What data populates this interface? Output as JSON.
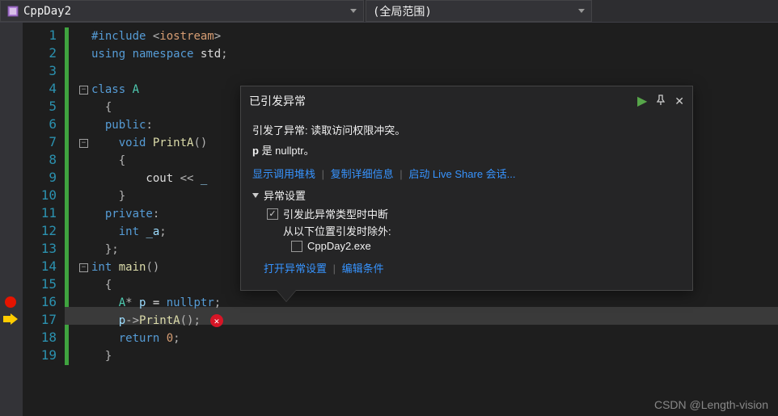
{
  "topbar": {
    "project": "CppDay2",
    "scope": "(全局范围)"
  },
  "code": {
    "lines": [
      {
        "n": 1,
        "t": [
          [
            "kw",
            "#include "
          ],
          [
            "op",
            "<"
          ],
          [
            "str",
            "iostream"
          ],
          [
            "op",
            ">"
          ]
        ]
      },
      {
        "n": 2,
        "t": [
          [
            "kw",
            "using namespace "
          ],
          [
            "white",
            "std"
          ],
          [
            "op",
            ";"
          ]
        ]
      },
      {
        "n": 3,
        "t": []
      },
      {
        "n": 4,
        "outline": true,
        "t": [
          [
            "kw",
            "class "
          ],
          [
            "type",
            "A"
          ]
        ]
      },
      {
        "n": 5,
        "t": [
          [
            "op",
            "  {"
          ]
        ]
      },
      {
        "n": 6,
        "t": [
          [
            "kw",
            "  public"
          ],
          [
            "op",
            ":"
          ]
        ]
      },
      {
        "n": 7,
        "outline": true,
        "t": [
          [
            "white",
            "    "
          ],
          [
            "kw",
            "void "
          ],
          [
            "func",
            "PrintA"
          ],
          [
            "op",
            "()"
          ]
        ]
      },
      {
        "n": 8,
        "t": [
          [
            "op",
            "    {"
          ]
        ]
      },
      {
        "n": 9,
        "t": [
          [
            "white",
            "        cout "
          ],
          [
            "op",
            "<< "
          ],
          [
            "var",
            "_"
          ]
        ]
      },
      {
        "n": 10,
        "t": [
          [
            "op",
            "    }"
          ]
        ]
      },
      {
        "n": 11,
        "t": [
          [
            "kw",
            "  private"
          ],
          [
            "op",
            ":"
          ]
        ]
      },
      {
        "n": 12,
        "t": [
          [
            "white",
            "    "
          ],
          [
            "kw",
            "int "
          ],
          [
            "var",
            "_a"
          ],
          [
            "op",
            ";"
          ]
        ]
      },
      {
        "n": 13,
        "t": [
          [
            "op",
            "  };"
          ]
        ]
      },
      {
        "n": 14,
        "outline": true,
        "t": [
          [
            "kw",
            "int "
          ],
          [
            "func",
            "main"
          ],
          [
            "op",
            "()"
          ]
        ]
      },
      {
        "n": 15,
        "t": [
          [
            "op",
            "  {"
          ]
        ]
      },
      {
        "n": 16,
        "t": [
          [
            "white",
            "    "
          ],
          [
            "type",
            "A"
          ],
          [
            "op",
            "* "
          ],
          [
            "var",
            "p"
          ],
          [
            "white",
            " = "
          ],
          [
            "kw",
            "nullptr"
          ],
          [
            "op",
            ";"
          ]
        ]
      },
      {
        "n": 17,
        "err": true,
        "t": [
          [
            "white",
            "    "
          ],
          [
            "var",
            "p"
          ],
          [
            "op",
            "->"
          ],
          [
            "func",
            "PrintA"
          ],
          [
            "op",
            "();"
          ]
        ]
      },
      {
        "n": 18,
        "t": [
          [
            "white",
            "    "
          ],
          [
            "kw",
            "return "
          ],
          [
            "str",
            "0"
          ],
          [
            "op",
            ";"
          ]
        ]
      },
      {
        "n": 19,
        "t": [
          [
            "op",
            "  }"
          ]
        ]
      }
    ]
  },
  "popup": {
    "title": "已引发异常",
    "message_line1": "引发了异常: 读取访问权限冲突。",
    "message_line2_pvar": "p",
    "message_line2_rest": " 是 nullptr。",
    "link_stack": "显示调用堆栈",
    "link_copy": "复制详细信息",
    "link_liveshare": "启动 Live Share 会话...",
    "settings_label": "异常设置",
    "check_break": "引发此异常类型时中断",
    "except_label": "从以下位置引发时除外:",
    "except_module": "CppDay2.exe",
    "link_open_settings": "打开异常设置",
    "link_edit_cond": "编辑条件"
  },
  "watermark": "CSDN @Length-vision"
}
